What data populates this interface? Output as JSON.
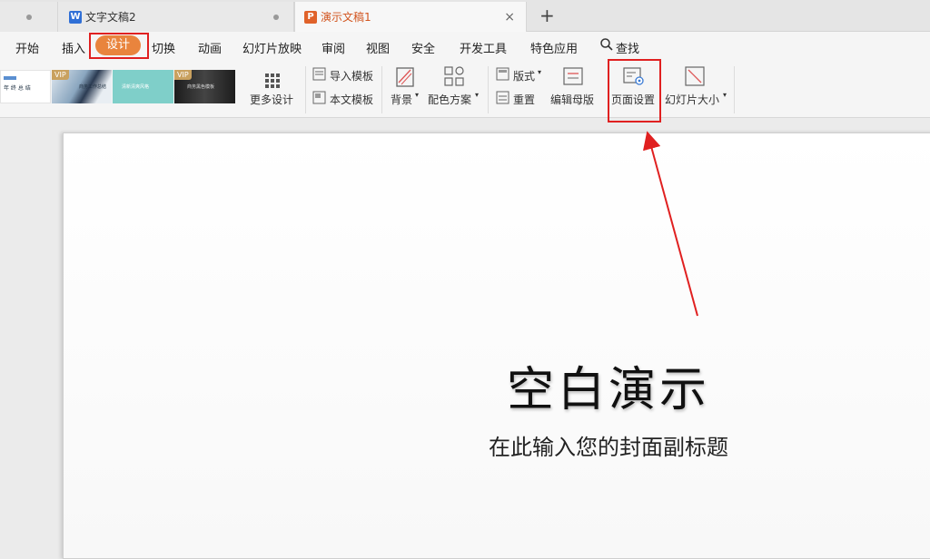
{
  "tabs": [
    {
      "label": "文字文稿2",
      "icon": "W",
      "icon_color": "#2f6fd6"
    },
    {
      "label": "演示文稿1",
      "icon": "P",
      "icon_color": "#e0622a",
      "close": "×"
    }
  ],
  "new_tab": "+",
  "menu": [
    "开始",
    "插入",
    "设计",
    "切换",
    "动画",
    "幻灯片放映",
    "审阅",
    "视图",
    "安全",
    "开发工具",
    "特色应用",
    "查找"
  ],
  "ribbon": {
    "templates": [
      {
        "vip": "",
        "text": "年 终 总 结"
      },
      {
        "vip": "VIP",
        "text": "商务工作总结"
      },
      {
        "vip": "",
        "text": "清新清爽风格"
      },
      {
        "vip": "VIP",
        "text": "商务黑色模板"
      }
    ],
    "more_design": "更多设计",
    "import_template": "导入模板",
    "this_template": "本文模板",
    "background": "背景",
    "color_scheme": "配色方案",
    "layout": "版式",
    "reset": "重置",
    "edit_master": "编辑母版",
    "page_setup": "页面设置",
    "slide_size": "幻灯片大小"
  },
  "slide": {
    "title": "空白演示",
    "subtitle": "在此输入您的封面副标题"
  },
  "colors": {
    "accent": "#e9843d",
    "annotation": "#e02020"
  }
}
